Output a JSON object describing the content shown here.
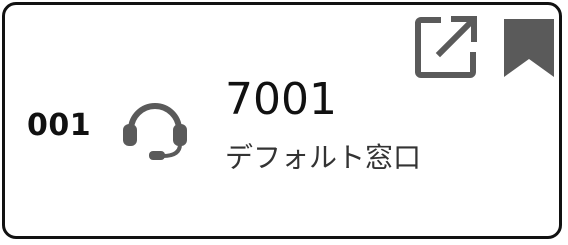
{
  "card": {
    "sequence": "001",
    "extension": "7001",
    "queue_name": "デフォルト窓口"
  },
  "icons": {
    "agent": "headset-icon",
    "open": "open-in-new-icon",
    "bookmark": "bookmark-icon"
  },
  "colors": {
    "icon": "#5a5a5a",
    "border": "#111111",
    "text": "#111111"
  }
}
